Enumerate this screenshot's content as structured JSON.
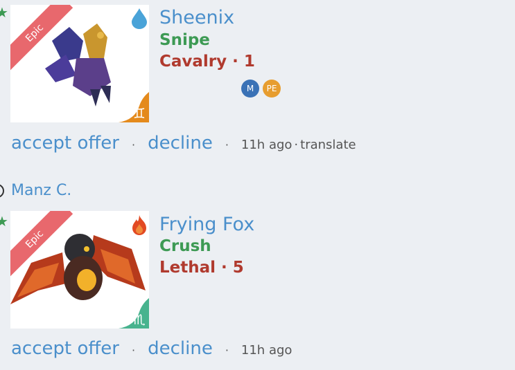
{
  "colors": {
    "link": "#4a8fcb",
    "type_green": "#3d9a54",
    "tier_red": "#b03a2e",
    "ribbon": "#e8686d",
    "water_sign": "#e48a1c",
    "scorpio_sign": "#48b38e"
  },
  "offers": [
    {
      "rarity": "Epic",
      "element_icon": "water-drop-icon",
      "name": "Sheenix",
      "type": "Snipe",
      "tier": "Cavalry · 1",
      "sign_icon": "gemini-icon",
      "badges": [
        "M",
        "PE"
      ],
      "accept_label": "accept offer",
      "decline_label": "decline",
      "time": "11h ago",
      "translate_label": "translate"
    },
    {
      "user": "Manz C.",
      "rarity": "Epic",
      "element_icon": "fire-icon",
      "name": "Frying Fox",
      "type": "Crush",
      "tier": "Lethal · 5",
      "sign_icon": "scorpio-icon",
      "accept_label": "accept offer",
      "decline_label": "decline",
      "time": "11h ago"
    }
  ],
  "separator": "·"
}
